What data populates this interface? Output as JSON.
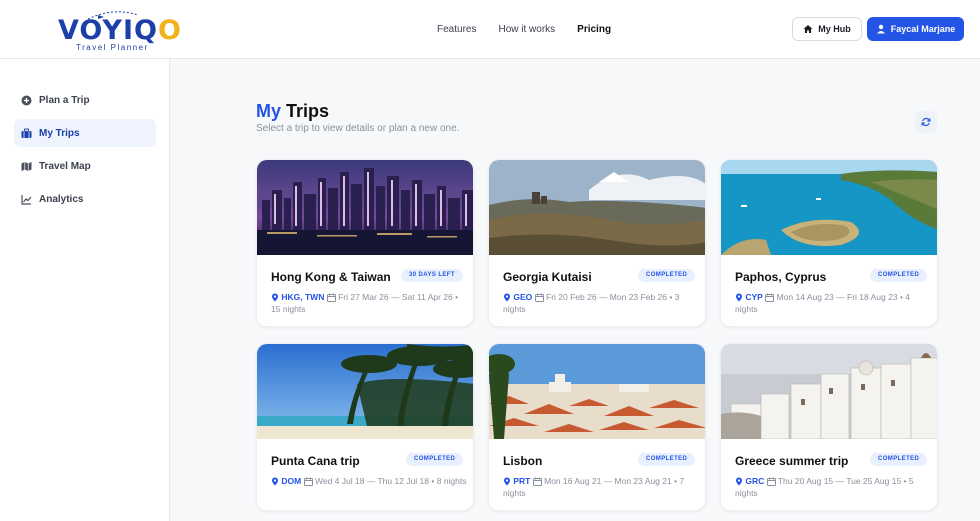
{
  "brand": {
    "name_start": "VOYIQ",
    "name_end": "O",
    "tagline": "Travel Planner",
    "colors": {
      "primary": "#2454e6",
      "accent": "#f1b21a"
    }
  },
  "nav": {
    "features": "Features",
    "how_it_works": "How it works",
    "pricing": "Pricing"
  },
  "header": {
    "hub_label": "My Hub",
    "user_label": "Faycal Marjane",
    "hub_icon": "home-icon",
    "user_icon": "user-icon"
  },
  "sidebar": {
    "items": [
      {
        "label": "Plan a Trip",
        "icon": "plus-circle-icon"
      },
      {
        "label": "My Trips",
        "icon": "suitcase-icon"
      },
      {
        "label": "Travel Map",
        "icon": "map-icon"
      },
      {
        "label": "Analytics",
        "icon": "chart-line-icon"
      }
    ]
  },
  "page": {
    "title_prefix": "My",
    "title_rest": " Trips",
    "subtitle": "Select a trip to view details or plan a new one.",
    "refresh_icon": "refresh-icon"
  },
  "trips": [
    {
      "name": "Hong Kong & Taiwan",
      "badge": "30 DAYS LEFT",
      "code": "HKG, TWN",
      "dates": "Fri 27 Mar 26 — Sat 11 Apr 26",
      "nights": "• 15 nights",
      "image": "city-night-skyline"
    },
    {
      "name": "Georgia Kutaisi",
      "badge": "COMPLETED",
      "code": "GEO",
      "dates": "Fri 20 Feb 26 — Mon 23 Feb 26 • 3",
      "nights": "nights",
      "image": "mountain-landscape"
    },
    {
      "name": "Paphos, Cyprus",
      "badge": "COMPLETED",
      "code": "CYP",
      "dates": "Mon 14 Aug 23 — Fri 18 Aug 23 • 4",
      "nights": "nights",
      "image": "coastal-bay"
    },
    {
      "name": "Punta Cana trip",
      "badge": "COMPLETED",
      "code": "DOM",
      "dates": "Wed 4 Jul 18 — Thu 12 Jul 18 • 8",
      "nights": "nights",
      "image": "palm-beach"
    },
    {
      "name": "Lisbon",
      "badge": "COMPLETED",
      "code": "PRT",
      "dates": "Mon 16 Aug 21 — Mon 23 Aug 21 • 7",
      "nights": "nights",
      "image": "red-roof-city"
    },
    {
      "name": "Greece summer trip",
      "badge": "COMPLETED",
      "code": "GRC",
      "dates": "Thu 20 Aug 15 — Tue 25 Aug 15 • 5",
      "nights": "nights",
      "image": "white-village"
    }
  ]
}
